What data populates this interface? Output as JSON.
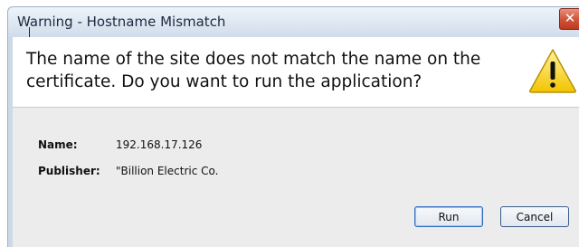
{
  "window": {
    "title": "Warning - Hostname Mismatch",
    "close_symbol": "✕"
  },
  "header": {
    "message": "The name of the site does not match the name on the certificate.  Do you want to run the application?",
    "icon": "warning-triangle-icon"
  },
  "details": {
    "name_label": "Name:",
    "name_value": "192.168.17.126",
    "publisher_label": "Publisher:",
    "publisher_value": "\"Billion Electric Co."
  },
  "buttons": {
    "run_label": "Run",
    "cancel_label": "Cancel"
  },
  "colors": {
    "warning_fill": "#f6d21d",
    "close_red": "#c0391f",
    "panel_gray": "#ececec"
  }
}
